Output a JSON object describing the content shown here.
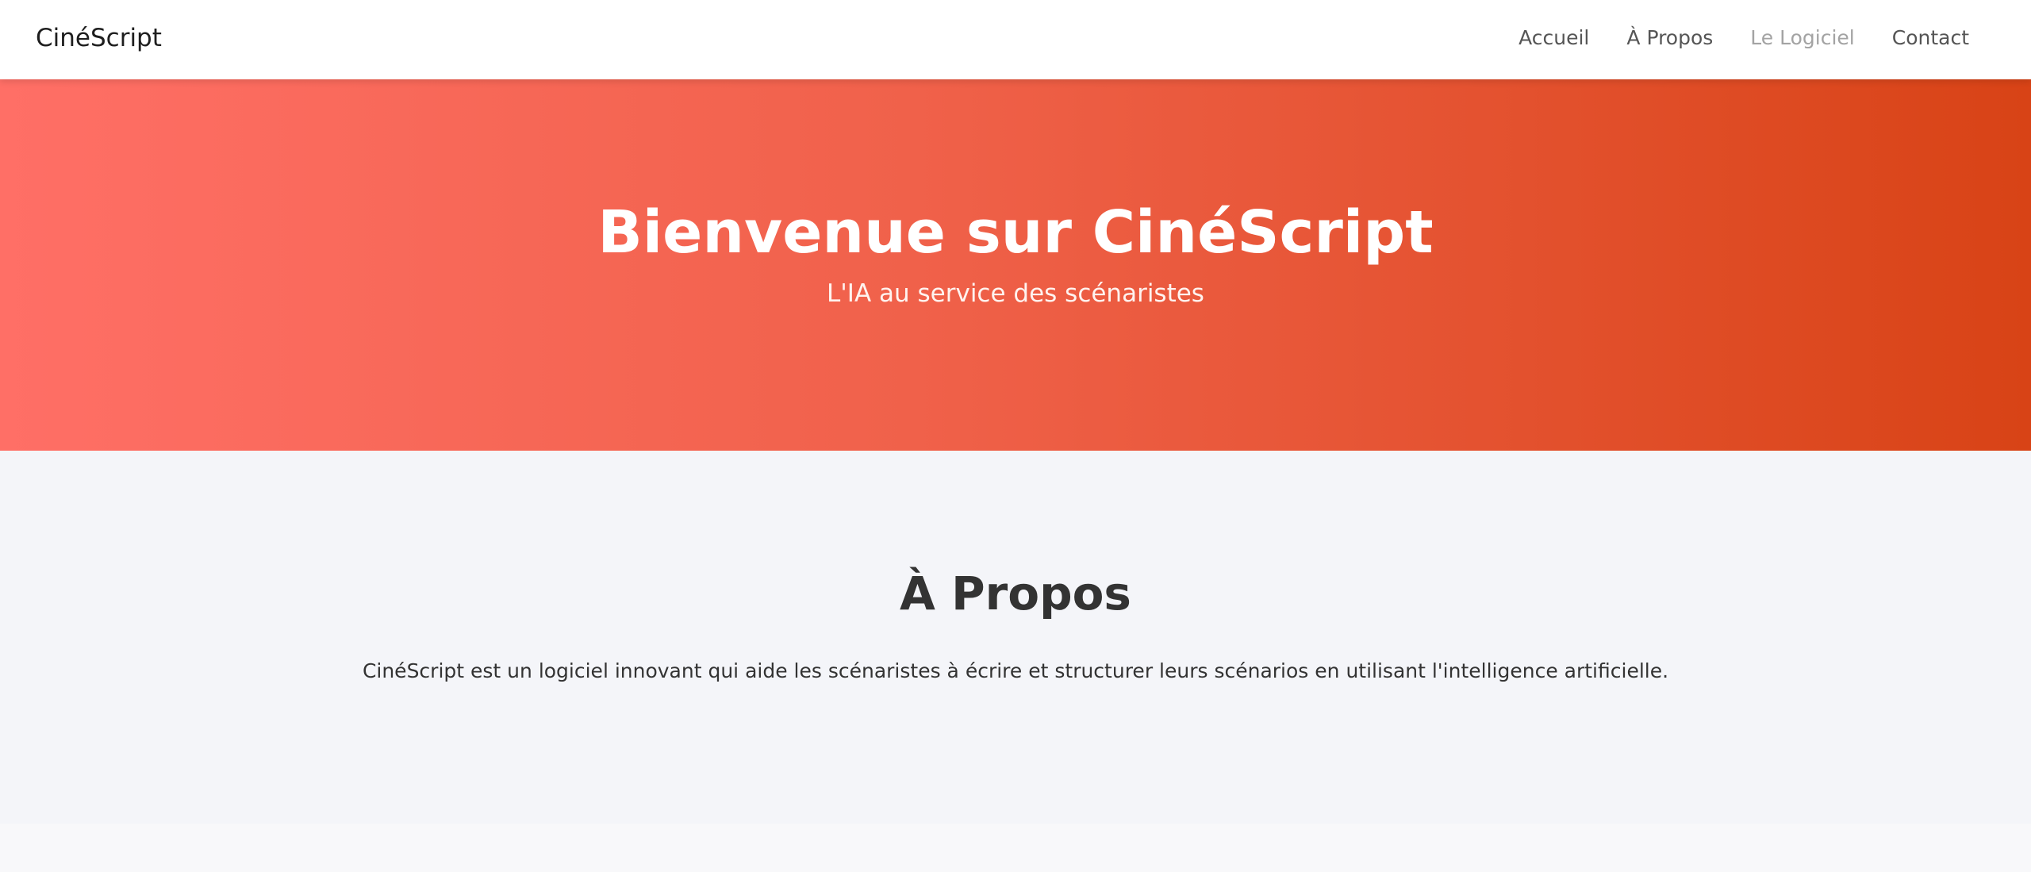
{
  "navbar": {
    "brand": "CinéScript",
    "links": [
      {
        "label": "Accueil"
      },
      {
        "label": "À Propos"
      },
      {
        "label": "Le Logiciel"
      },
      {
        "label": "Contact"
      }
    ]
  },
  "hero": {
    "title": "Bienvenue sur CinéScript",
    "subtitle": "L'IA au service des scénaristes"
  },
  "about": {
    "title": "À Propos",
    "text": "CinéScript est un logiciel innovant qui aide les scénaristes à écrire et structurer leurs scénarios en utilisant l'intelligence artificielle."
  },
  "colors": {
    "accent_start": "#ff6f66",
    "accent_end": "#d84316",
    "section_bg": "#f4f5f9"
  }
}
